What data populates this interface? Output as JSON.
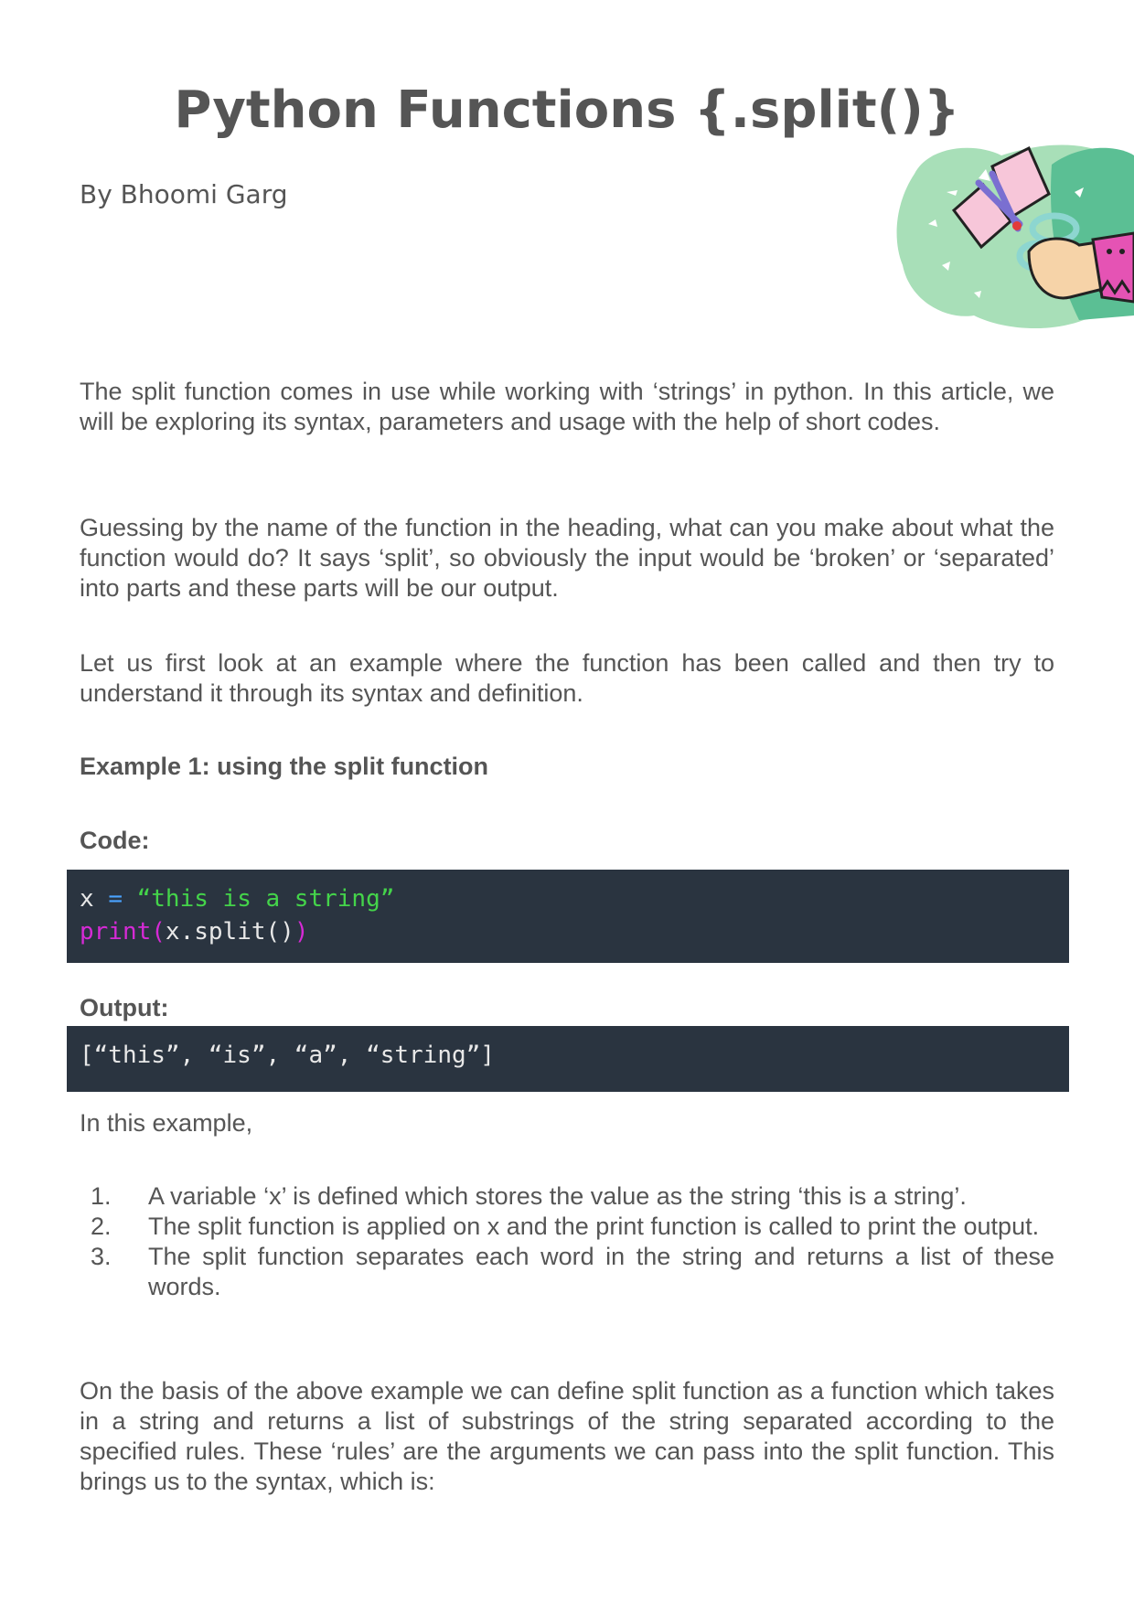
{
  "title": "Python Functions {.split()}",
  "author": "By Bhoomi Garg",
  "illustration_icon": "scissors-cutting-paper-illustration",
  "paragraphs": {
    "intro": "The split function comes in use while working with ‘strings’ in python. In this article, we will be exploring its syntax, parameters and usage with the help of short codes.",
    "guess": "Guessing by the name of the function in the heading, what can you make about what the function would do? It says ‘split’, so obviously the input would be ‘broken’ or ‘separated’ into parts and these parts will be our output.",
    "first_look": "Let us first look at an example where the function has been called and then try to understand it through its syntax and definition.",
    "in_example": "In this example,",
    "basis": "On the basis of the above example we can define split function as a function which takes in a string and returns a list of substrings of the string separated according to the specified rules. These ‘rules’ are the arguments we can pass into the split function. This brings us to the syntax, which is:"
  },
  "example_heading": "Example 1: using the split function",
  "code_label": "Code:",
  "code": {
    "line1_var": "x",
    "line1_op": "=",
    "line1_str": "“this is a string”",
    "line2_kw": "print(",
    "line2_body": "x.split()",
    "line2_close": ")"
  },
  "output_label": "Output:",
  "output": "[“this”, “is”, “a”, “string”]",
  "steps": [
    {
      "num": "1.",
      "text": "A variable ‘x’ is defined which stores the value as the string ‘this is a string’."
    },
    {
      "num": "2.",
      "text": "The split function is applied on x and the print function is called to print the output."
    },
    {
      "num": "3.",
      "text": "The split function separates each word in the string and returns a list of these words."
    }
  ],
  "colors": {
    "code_bg": "#2a3440",
    "keyword": "#d62ad6",
    "string": "#44d44a",
    "operator": "#4aa3ff",
    "text": "#555555"
  }
}
